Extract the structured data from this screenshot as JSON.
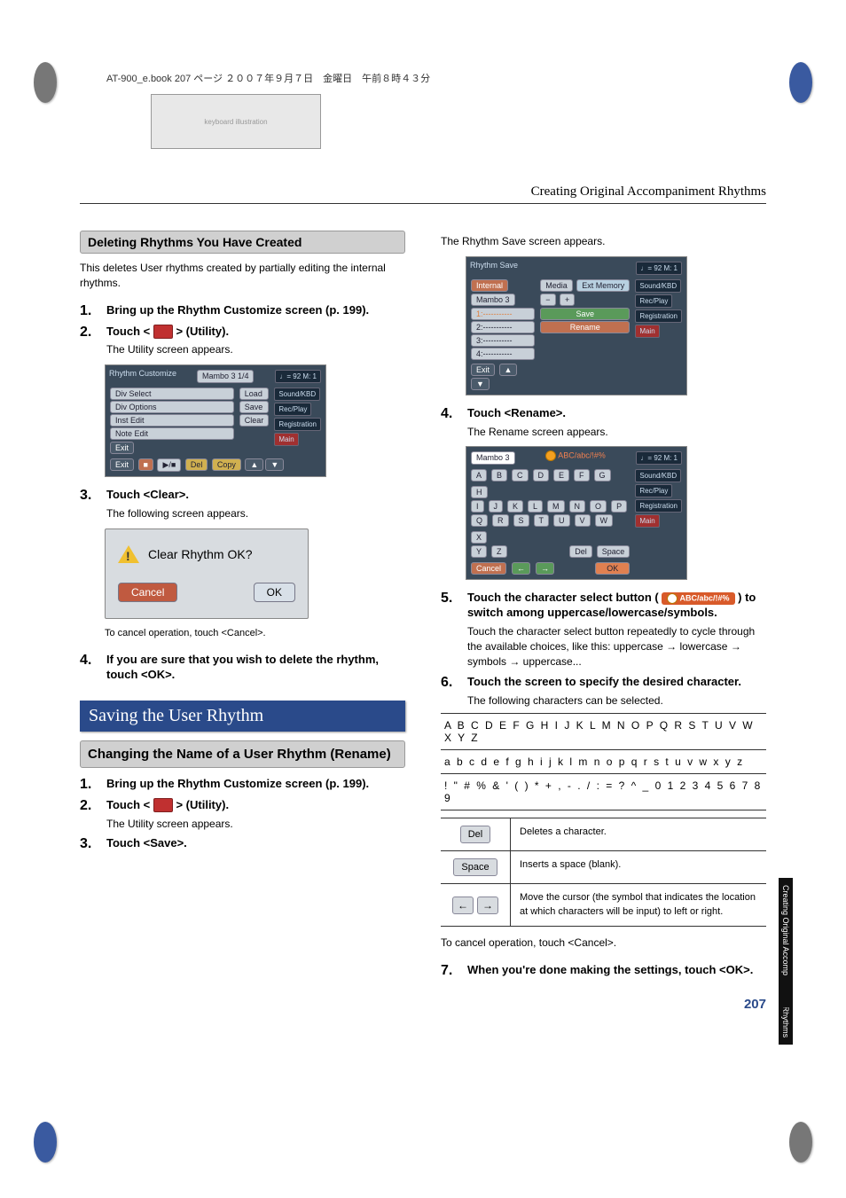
{
  "header_line": "AT-900_e.book  207 ページ  ２００７年９月７日　金曜日　午前８時４３分",
  "section_title": "Creating Original Accompaniment Rhythms",
  "side_tab": "Creating Original Accompaniment Rhythms",
  "page_number": "207",
  "left": {
    "heading1": "Deleting Rhythms You Have Created",
    "intro": "This deletes User rhythms created by partially editing the internal rhythms.",
    "s1": {
      "num": "1.",
      "title": "Bring up the Rhythm Customize screen (p. 199)."
    },
    "s2": {
      "num": "2.",
      "title_pre": "Touch < ",
      "title_post": " > (Utility).",
      "desc": "The Utility screen appears."
    },
    "s3": {
      "num": "3.",
      "title": "Touch <Clear>.",
      "desc": "The following screen appears."
    },
    "confirm": {
      "msg": "Clear Rhythm OK?",
      "cancel": "Cancel",
      "ok": "OK"
    },
    "cancel_note": "To cancel operation, touch <Cancel>.",
    "s4": {
      "num": "4.",
      "title": "If you are sure that you wish to delete the rhythm, touch <OK>."
    },
    "blue_heading": "Saving the User Rhythm",
    "heading2": "Changing the Name of a User Rhythm (Rename)",
    "r1": {
      "num": "1.",
      "title": "Bring up the Rhythm Customize screen (p. 199)."
    },
    "r2": {
      "num": "2.",
      "title_pre": "Touch < ",
      "title_post": " > (Utility).",
      "desc": "The Utility screen appears."
    },
    "r3": {
      "num": "3.",
      "title": "Touch <Save>."
    },
    "utility_screen": {
      "title": "Rhythm Customize",
      "sub": "Mambo 3   1/4",
      "tempo": "♩= 92  M: 1",
      "items": [
        "Div Select",
        "Div Options",
        "Inst Edit",
        "Note Edit"
      ],
      "rcol": [
        "Load",
        "Save",
        "Clear"
      ],
      "exit": "Exit",
      "del": "Del",
      "copy": "Copy",
      "side": [
        "Sound/KBD",
        "Rec/Play",
        "Registration",
        "Main"
      ]
    }
  },
  "right": {
    "intro": "The Rhythm Save screen appears.",
    "s4": {
      "num": "4.",
      "title": "Touch <Rename>.",
      "desc": "The Rename screen appears."
    },
    "s5": {
      "num": "5.",
      "title_pre": "Touch the character select button ( ",
      "title_mid": "ABC/abc/!#%",
      "title_post": " ) to switch among uppercase/lowercase/symbols.",
      "desc": "Touch the character select button repeatedly to cycle through the available choices, like this: uppercase → lowercase → symbols → uppercase..."
    },
    "s6": {
      "num": "6.",
      "title": "Touch the screen to specify the desired character.",
      "desc": "The following characters can be selected."
    },
    "chars": {
      "upper": "A B C D E F G H I J K L M N O P Q R S T U V W X Y Z",
      "lower": "a b c d e f g h i j k l m n o p q r s t u v w x y z",
      "sym": "! \" # % & ' ( ) * + , - . / : = ? ^ _ 0 1 2 3 4 5 6 7 8 9"
    },
    "btns": {
      "del": "Del",
      "del_desc": "Deletes a character.",
      "space": "Space",
      "space_desc": "Inserts a space (blank).",
      "arrows_desc": "Move the cursor (the symbol that indicates the location at which characters will be input) to left or right."
    },
    "cancel_note": "To cancel operation, touch <Cancel>.",
    "s7": {
      "num": "7.",
      "title": "When you're done making the settings, touch <OK>."
    },
    "save_screen": {
      "title": "Rhythm Save",
      "loc_int": "Internal",
      "loc_name": "Mambo 3",
      "media": "Media",
      "ext": "Ext Memory",
      "slots": [
        "1:-----------",
        "2:-----------",
        "3:-----------",
        "4:-----------"
      ],
      "save": "Save",
      "rename": "Rename",
      "exit": "Exit",
      "minus": "−",
      "plus": "+",
      "tempo": "♩= 92  M: 1",
      "side": [
        "Sound/KBD",
        "Rec/Play",
        "Registration",
        "Main"
      ]
    },
    "rename_screen": {
      "name": "Mambo 3",
      "mode": "ABC/abc/!#%",
      "tempo": "♩= 92  M: 1",
      "rows": [
        [
          "A",
          "B",
          "C",
          "D",
          "E",
          "F",
          "G",
          "H"
        ],
        [
          "I",
          "J",
          "K",
          "L",
          "M",
          "N",
          "O",
          "P"
        ],
        [
          "Q",
          "R",
          "S",
          "T",
          "U",
          "V",
          "W",
          "X"
        ],
        [
          "Y",
          "Z"
        ]
      ],
      "del": "Del",
      "space": "Space",
      "cancel": "Cancel",
      "ok": "OK",
      "side": [
        "Sound/KBD",
        "Rec/Play",
        "Registration",
        "Main"
      ]
    }
  }
}
